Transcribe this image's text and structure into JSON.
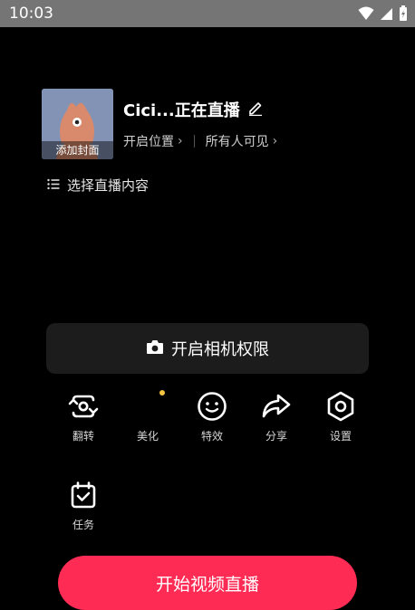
{
  "status_bar": {
    "time": "10:03"
  },
  "cover": {
    "label": "添加封面"
  },
  "room": {
    "title": "Cici...正在直播"
  },
  "meta": {
    "location": "开启位置",
    "visibility": "所有人可见"
  },
  "content_select": {
    "label": "选择直播内容"
  },
  "camera": {
    "label": "开启相机权限"
  },
  "tools": {
    "flip": "翻转",
    "beauty": "美化",
    "effects": "特效",
    "share": "分享",
    "settings": "设置",
    "tasks": "任务"
  },
  "start": {
    "label": "开始视频直播"
  },
  "colors": {
    "accent": "#fe2c55",
    "dot": "#f5c542",
    "status_bar": "#757575"
  }
}
